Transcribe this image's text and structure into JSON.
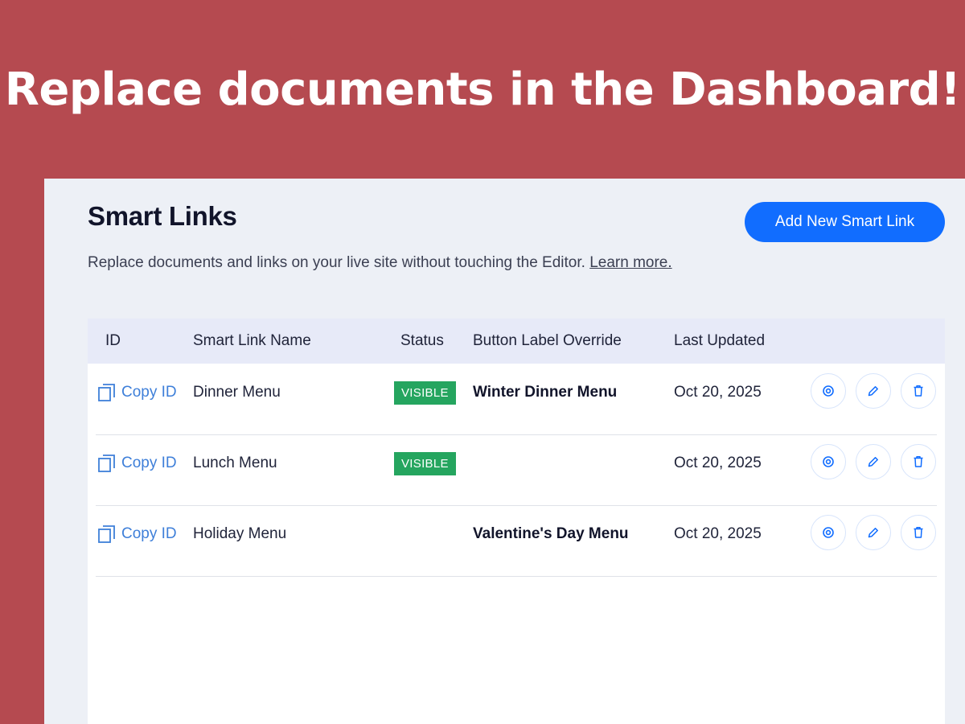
{
  "banner": {
    "title": "Replace documents in the Dashboard!"
  },
  "page": {
    "title": "Smart Links",
    "add_button_label": "Add New Smart Link",
    "subtitle": "Replace documents and links on your live site without touching the Editor.",
    "learn_more_label": "Learn more."
  },
  "table": {
    "columns": {
      "id": "ID",
      "name": "Smart Link Name",
      "status": "Status",
      "label_override": "Button Label Override",
      "last_updated": "Last Updated"
    },
    "copy_id_label": "Copy ID",
    "rows": [
      {
        "name": "Dinner Menu",
        "status": "VISIBLE",
        "label_override": "Winter Dinner Menu",
        "last_updated": "Oct 20, 2025"
      },
      {
        "name": "Lunch Menu",
        "status": "VISIBLE",
        "label_override": "",
        "last_updated": "Oct 20, 2025"
      },
      {
        "name": "Holiday Menu",
        "status": "",
        "label_override": "Valentine's Day Menu",
        "last_updated": "Oct 20, 2025"
      }
    ],
    "row_actions": [
      "eye-icon",
      "pencil-icon",
      "trash-icon"
    ]
  },
  "colors": {
    "banner_background": "#b54a50",
    "panel_background": "#edf0f6",
    "primary_button": "#116dff",
    "link_blue": "#3e7fd9",
    "visible_badge": "#25a55f",
    "header_row": "#e7eaf8"
  }
}
